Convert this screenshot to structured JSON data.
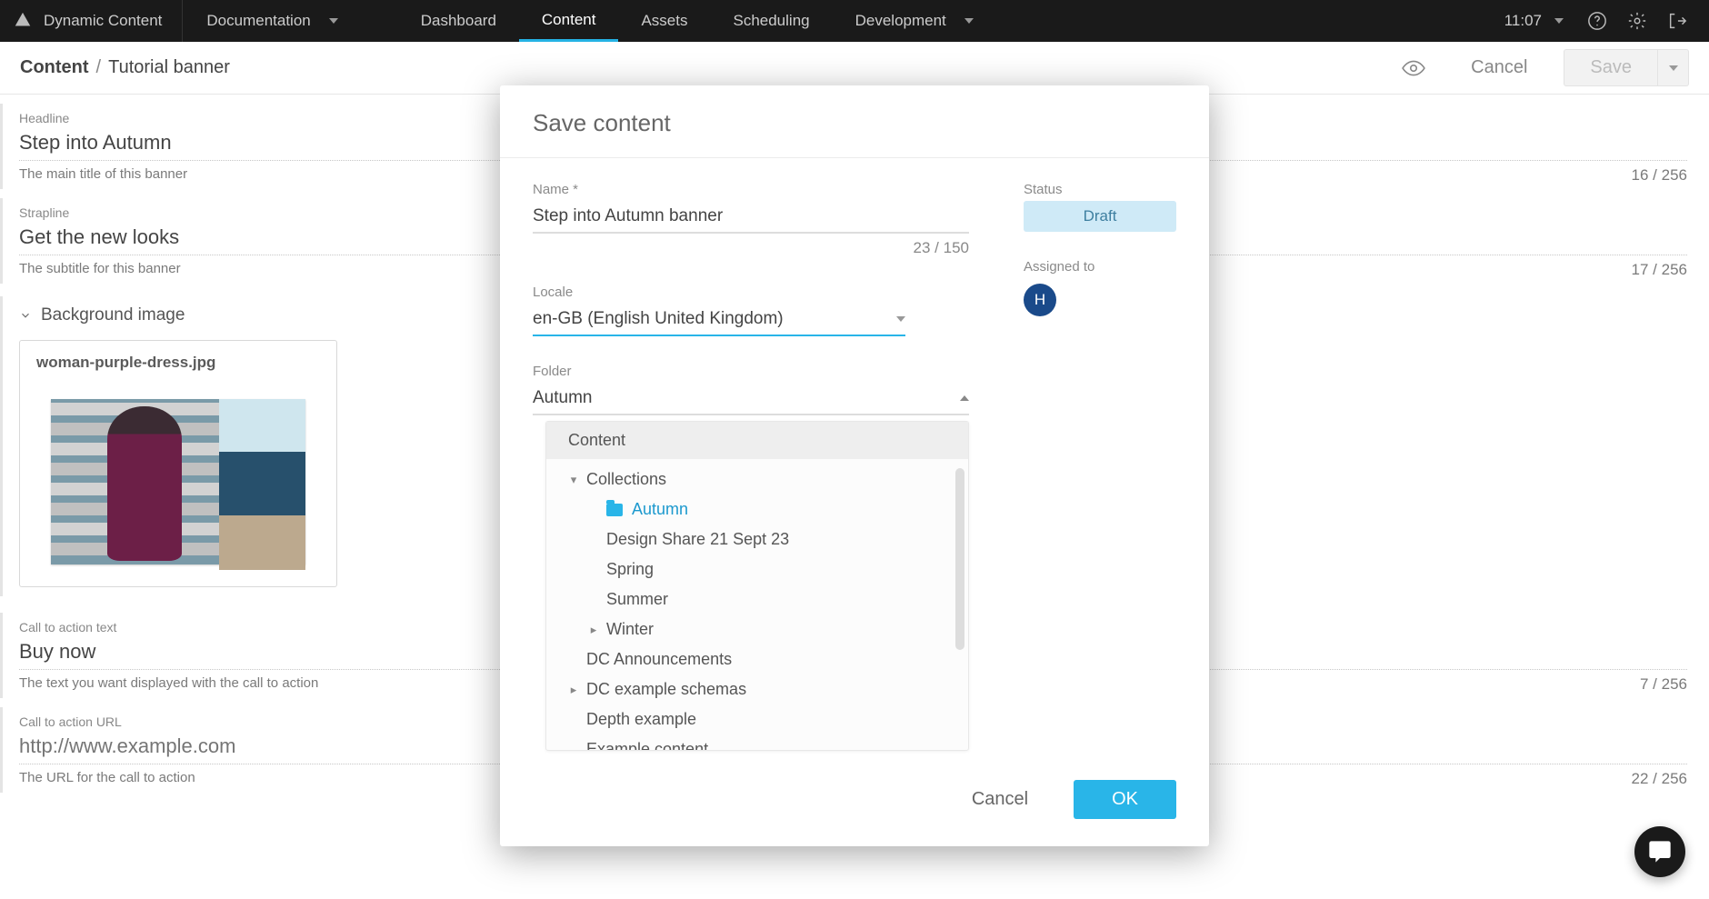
{
  "brand": "Dynamic Content",
  "nav": {
    "documentation": "Documentation",
    "items": [
      "Dashboard",
      "Content",
      "Assets",
      "Scheduling"
    ],
    "active_index": 1,
    "development": "Development",
    "time": "11:07"
  },
  "breadcrumb": {
    "root": "Content",
    "leaf": "Tutorial banner"
  },
  "actions": {
    "cancel": "Cancel",
    "save": "Save"
  },
  "fields": {
    "headline": {
      "label": "Headline",
      "value": "Step into Autumn",
      "hint": "The main title of this banner",
      "count": "16 / 256"
    },
    "strapline": {
      "label": "Strapline",
      "value": "Get the new looks",
      "hint": "The subtitle for this banner",
      "count": "17 / 256"
    },
    "bgimage": {
      "section_title": "Background image",
      "filename": "woman-purple-dress.jpg"
    },
    "cta_text": {
      "label": "Call to action text",
      "value": "Buy now",
      "hint": "The text you want displayed with the call to action",
      "count": "7 / 256"
    },
    "cta_url": {
      "label": "Call to action URL",
      "value": "",
      "placeholder": "http://www.example.com",
      "hint": "The URL for the call to action",
      "count": "22 / 256"
    }
  },
  "modal": {
    "title": "Save content",
    "name_label": "Name *",
    "name_value": "Step into Autumn banner",
    "name_count": "23 / 150",
    "locale_label": "Locale",
    "locale_value": "en-GB (English United Kingdom)",
    "folder_label": "Folder",
    "folder_value": "Autumn",
    "status_label": "Status",
    "status_value": "Draft",
    "assigned_label": "Assigned to",
    "assigned_initial": "H",
    "tree_header": "Content",
    "tree": {
      "collections": "Collections",
      "autumn": "Autumn",
      "design_share": "Design Share 21 Sept 23",
      "spring": "Spring",
      "summer": "Summer",
      "winter": "Winter",
      "dc_announce": "DC Announcements",
      "dc_schemas": "DC example schemas",
      "depth": "Depth example",
      "example": "Example content"
    },
    "cancel": "Cancel",
    "ok": "OK"
  }
}
